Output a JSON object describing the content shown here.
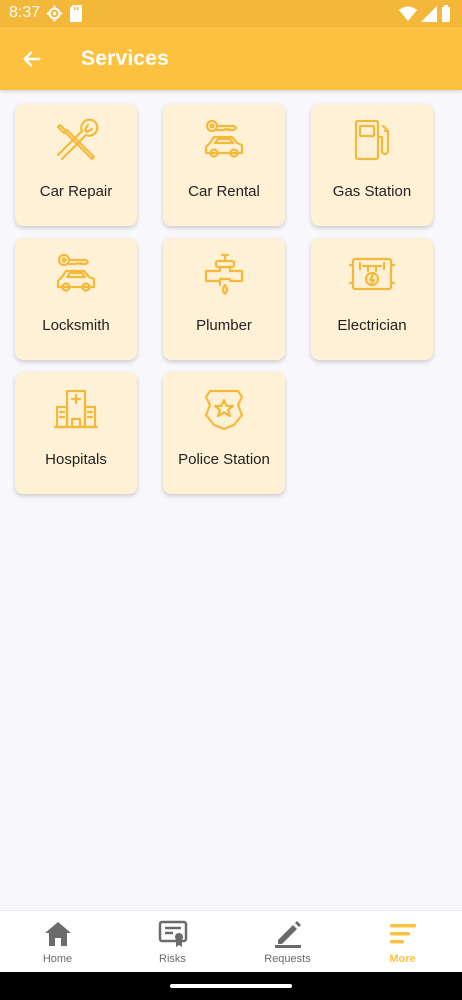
{
  "status_bar": {
    "time": "8:37",
    "color": "#f3b73a"
  },
  "header": {
    "title": "Services",
    "color": "#fcc23f"
  },
  "services": [
    {
      "label": "Car Repair",
      "icon": "wrench-screwdriver-icon"
    },
    {
      "label": "Car Rental",
      "icon": "car-key-icon"
    },
    {
      "label": "Gas Station",
      "icon": "fuel-pump-icon"
    },
    {
      "label": "Locksmith",
      "icon": "car-key-icon"
    },
    {
      "label": "Plumber",
      "icon": "pipe-faucet-icon"
    },
    {
      "label": "Electrician",
      "icon": "electric-panel-icon"
    },
    {
      "label": "Hospitals",
      "icon": "hospital-icon"
    },
    {
      "label": "Police Station",
      "icon": "police-badge-icon"
    }
  ],
  "nav": [
    {
      "label": "Home",
      "icon": "home-icon",
      "active": false
    },
    {
      "label": "Risks",
      "icon": "certificate-icon",
      "active": false
    },
    {
      "label": "Requests",
      "icon": "pencil-icon",
      "active": false
    },
    {
      "label": "More",
      "icon": "menu-icon",
      "active": true
    }
  ],
  "colors": {
    "accent": "#fcc23f",
    "tile_bg": "#fff1d6",
    "icon_stroke": "#f4b93a"
  }
}
